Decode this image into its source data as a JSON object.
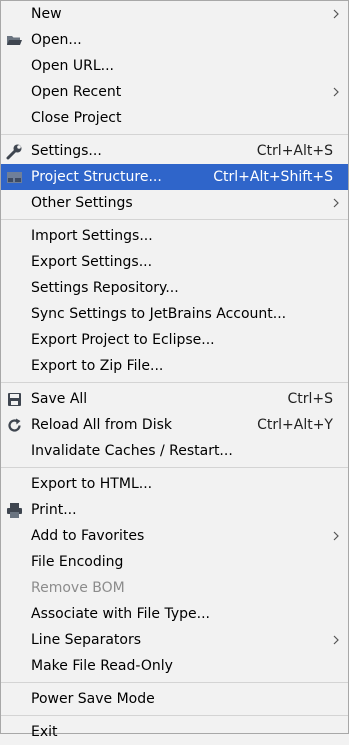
{
  "menu": {
    "items": [
      {
        "label": "New",
        "submenu": true
      },
      {
        "label": "Open...",
        "icon": "folder-icon"
      },
      {
        "label": "Open URL..."
      },
      {
        "label": "Open Recent",
        "submenu": true
      },
      {
        "label": "Close Project"
      },
      {
        "label": "Settings...",
        "shortcut": "Ctrl+Alt+S",
        "icon": "wrench-icon"
      },
      {
        "label": "Project Structure...",
        "shortcut": "Ctrl+Alt+Shift+S",
        "icon": "project-structure-icon",
        "selected": true
      },
      {
        "label": "Other Settings",
        "submenu": true
      },
      {
        "label": "Import Settings..."
      },
      {
        "label": "Export Settings..."
      },
      {
        "label": "Settings Repository..."
      },
      {
        "label": "Sync Settings to JetBrains Account..."
      },
      {
        "label": "Export Project to Eclipse..."
      },
      {
        "label": "Export to Zip File..."
      },
      {
        "label": "Save All",
        "shortcut": "Ctrl+S",
        "icon": "save-icon"
      },
      {
        "label": "Reload All from Disk",
        "shortcut": "Ctrl+Alt+Y",
        "icon": "reload-icon"
      },
      {
        "label": "Invalidate Caches / Restart..."
      },
      {
        "label": "Export to HTML..."
      },
      {
        "label": "Print...",
        "icon": "print-icon"
      },
      {
        "label": "Add to Favorites",
        "submenu": true
      },
      {
        "label": "File Encoding"
      },
      {
        "label": "Remove BOM",
        "disabled": true
      },
      {
        "label": "Associate with File Type..."
      },
      {
        "label": "Line Separators",
        "submenu": true
      },
      {
        "label": "Make File Read-Only"
      },
      {
        "label": "Power Save Mode"
      },
      {
        "label": "Exit"
      }
    ]
  },
  "colors": {
    "background": "#f2f2f2",
    "selection": "#2f65ca",
    "disabled_text": "#8c8c8c",
    "separator": "#d4d4d4"
  }
}
